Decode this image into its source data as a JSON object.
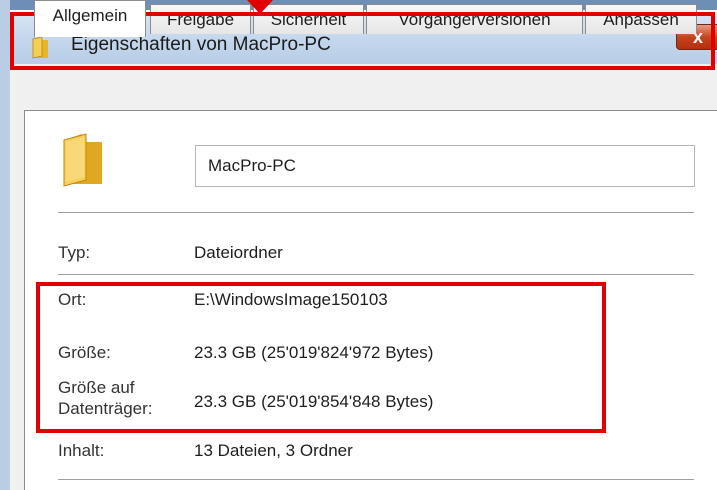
{
  "window": {
    "title": "Eigenschaften von MacPro-PC",
    "close_label": "x"
  },
  "tabs": [
    {
      "label": "Allgemein",
      "active": true
    },
    {
      "label": "Freigabe",
      "active": false
    },
    {
      "label": "Sicherheit",
      "active": false
    },
    {
      "label": "Vorgängerversionen",
      "active": false
    },
    {
      "label": "Anpassen",
      "active": false
    }
  ],
  "general": {
    "name_value": "MacPro-PC",
    "rows": {
      "type": {
        "label": "Typ:",
        "value": "Dateiordner"
      },
      "location": {
        "label": "Ort:",
        "value": "E:\\WindowsImage150103"
      },
      "size": {
        "label": "Größe:",
        "value": "23.3 GB (25'019'824'972 Bytes)"
      },
      "size_on_disk": {
        "label_line1": "Größe auf",
        "label_line2": "Datenträger:",
        "value": "23.3 GB (25'019'854'848 Bytes)"
      },
      "contents": {
        "label": "Inhalt:",
        "value": "13 Dateien, 3 Ordner"
      }
    }
  },
  "icons": {
    "title": "folder-icon",
    "main": "folder-icon",
    "close": "close-icon"
  },
  "colors": {
    "highlight": "#e00000",
    "close_button": "#c8431f",
    "folder": "#f0c040"
  }
}
